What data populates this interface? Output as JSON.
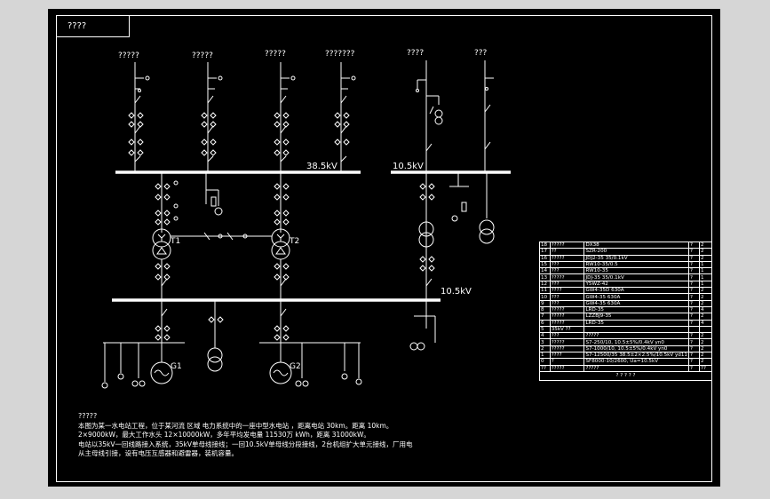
{
  "drawing": {
    "title": "????"
  },
  "feeders": {
    "top_left": [
      "?????",
      "?????",
      "?????",
      "???????"
    ],
    "top_right": [
      "????",
      "???"
    ]
  },
  "buses": {
    "bus_35": "38.5kV",
    "bus_10_right": "10.5kV",
    "bus_10_main": "10.5kV"
  },
  "units": {
    "t1": "T1",
    "t2": "T2",
    "g1": "G1",
    "g2": "G2"
  },
  "notes": {
    "heading": "?????",
    "line1": "本图为某一水电站工程，位于某河流 区域 电力系统中的一座中型水电站 ，距离电站 30km。距离 10km。",
    "line2": "2×9000kW，最大工作水头 12×10000kW，多年平均发电量 11530万 kWh，距离 31000kW。",
    "line3": "电站以35kV一回线路接入系统，35kV单母线接线；一回10.5kV单母线分段接线，2台机组扩大单元接线，厂用电",
    "line4": "从主母线引接，设有电压互感器和避雷器，装机容量。"
  },
  "table": {
    "rows": [
      [
        "18",
        "?????",
        "DX38",
        "?",
        "2"
      ],
      [
        "17",
        "??",
        "SZR-200",
        "?",
        "2"
      ],
      [
        "16",
        "?????",
        "JDJ2-35  35/0.1kV",
        "?",
        "2"
      ],
      [
        "15",
        "???",
        "RW10-35/0.5",
        "?",
        "1"
      ],
      [
        "14",
        "???",
        "RW10-35",
        "?",
        "1"
      ],
      [
        "13",
        "?????",
        "JDJ-35 35/0.1kV",
        "?",
        "1"
      ],
      [
        "12",
        "???",
        "Y5WZ-42",
        "?",
        "1"
      ],
      [
        "11",
        "????",
        "GW4-35D 630A",
        "?",
        "2"
      ],
      [
        "10",
        "???",
        "GW4-35 630A",
        "?",
        "2"
      ],
      [
        "9",
        "???",
        "GW4-35  630A",
        "?",
        "2"
      ],
      [
        "8",
        "?????",
        "LRD-35",
        "?",
        "4"
      ],
      [
        "7",
        "?????",
        "LZZBJ9-35",
        "?",
        "2"
      ],
      [
        "6",
        "?????",
        "LRD-35",
        "?",
        "4"
      ],
      [
        "5",
        "35kV ??",
        "",
        "",
        ""
      ],
      [
        "4",
        "???",
        "?????",
        "?",
        "2"
      ],
      [
        "3",
        "?????",
        "S7-250/10,  10.5±5%/0.4kV yn0",
        "?",
        "2"
      ],
      [
        "2",
        "?????",
        "S7-1000/10,  10.5±5%/0.4kV yn0",
        "?",
        "2"
      ],
      [
        "1",
        "????",
        "S7-12500/35  38.5±2×2.5%/10.5kV yd11",
        "?",
        "2"
      ],
      [
        "0",
        "?",
        "SF8000-10/2600,  Ua=10.5kV",
        "?",
        "2"
      ],
      [
        "??",
        "?????",
        "?????",
        "?",
        "??"
      ]
    ],
    "footer": "? ? ? ? ?"
  }
}
